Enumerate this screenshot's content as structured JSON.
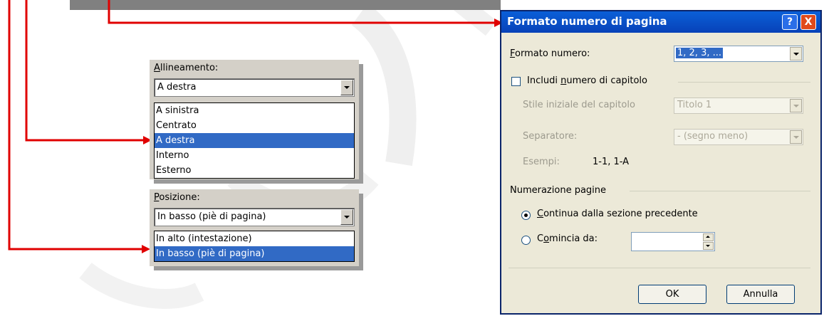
{
  "allineamento": {
    "label_prefix": "A",
    "label_rest": "llineamento:",
    "value": "A destra",
    "options": [
      "A sinistra",
      "Centrato",
      "A destra",
      "Interno",
      "Esterno"
    ],
    "selected_index": 2
  },
  "posizione": {
    "label_prefix": "P",
    "label_rest": "osizione:",
    "value": "In basso (piè di pagina)",
    "options": [
      "In alto (intestazione)",
      "In basso (piè di pagina)"
    ],
    "selected_index": 1
  },
  "dialog": {
    "title": "Formato numero di pagina",
    "help_glyph": "?",
    "close_glyph": "X",
    "formato_label_prefix": "F",
    "formato_label_rest": "ormato numero:",
    "formato_value": "1, 2, 3, ...",
    "includi_label_prefix": "Includi ",
    "includi_label_u": "n",
    "includi_label_rest": "umero di capitolo",
    "stile_label": "Stile iniziale del capitolo",
    "stile_value": "Titolo 1",
    "separatore_label": "Separatore:",
    "separatore_value": "-   (segno meno)",
    "esempi_label": "Esempi:",
    "esempi_value": "1-1, 1-A",
    "numerazione_label": "Numerazione pagine",
    "continua_prefix": "",
    "continua_u": "C",
    "continua_rest": "ontinua dalla sezione precedente",
    "comincia_prefix": "C",
    "comincia_u": "o",
    "comincia_rest": "mincia da:",
    "comincia_value": "",
    "ok_label": "OK",
    "annulla_label": "Annulla"
  },
  "colors": {
    "selection": "#316ac5",
    "arrow": "#e00000",
    "title_bar": "#0a5fd8"
  }
}
